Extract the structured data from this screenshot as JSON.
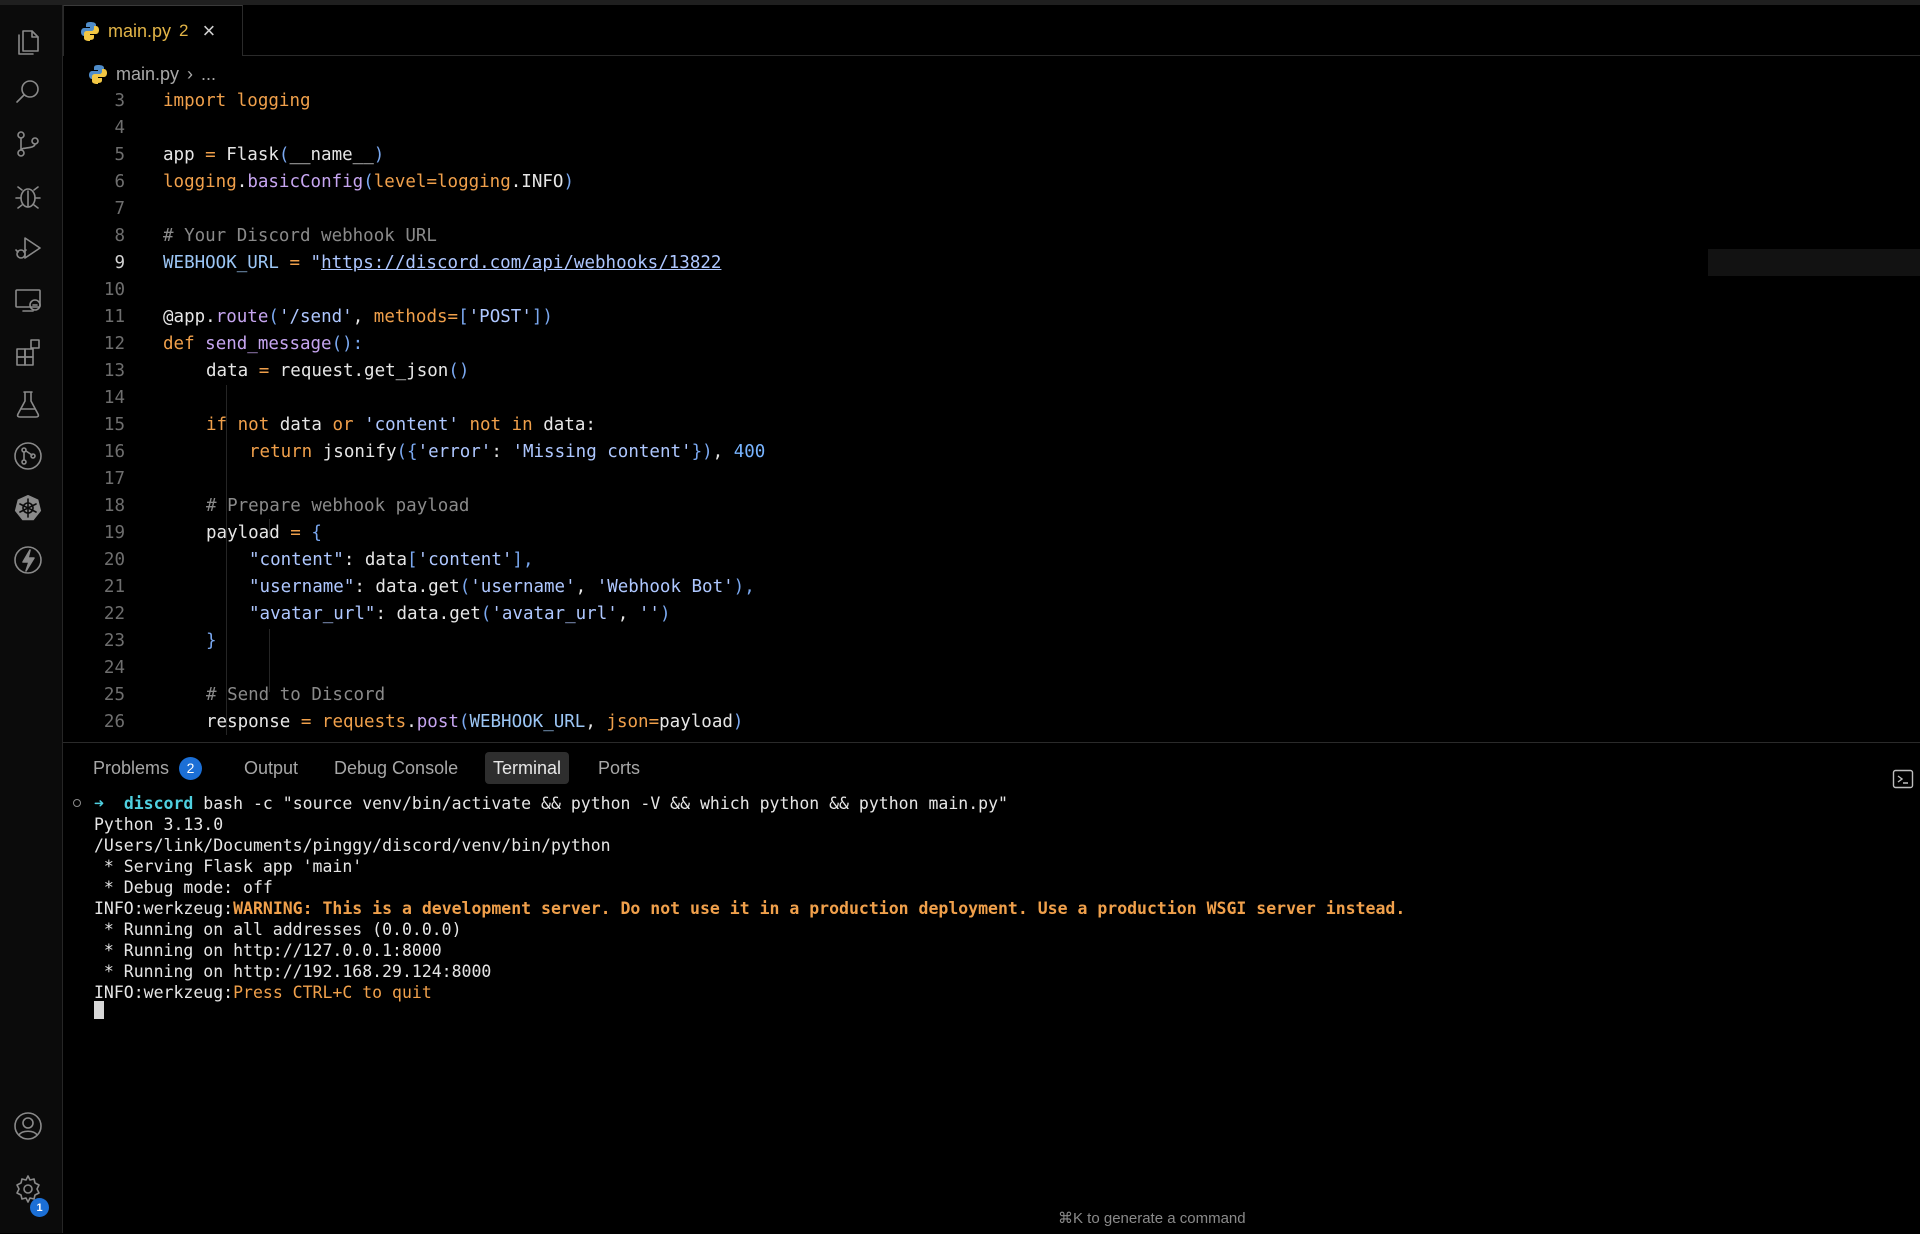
{
  "editor": {
    "tab": {
      "filename": "main.py",
      "problem_count": "2",
      "close_glyph": "×"
    },
    "breadcrumb": {
      "file": "main.py",
      "sep": "›",
      "rest": "..."
    },
    "lines": [
      {
        "n": "3"
      },
      {
        "n": "4"
      },
      {
        "n": "5"
      },
      {
        "n": "6"
      },
      {
        "n": "7"
      },
      {
        "n": "8"
      },
      {
        "n": "9"
      },
      {
        "n": "10"
      },
      {
        "n": "11"
      },
      {
        "n": "12"
      },
      {
        "n": "13"
      },
      {
        "n": "14"
      },
      {
        "n": "15"
      },
      {
        "n": "16"
      },
      {
        "n": "17"
      },
      {
        "n": "18"
      },
      {
        "n": "19"
      },
      {
        "n": "20"
      },
      {
        "n": "21"
      },
      {
        "n": "22"
      },
      {
        "n": "23"
      },
      {
        "n": "24"
      },
      {
        "n": "25"
      },
      {
        "n": "26"
      }
    ],
    "code": {
      "l3": [
        "import",
        " ",
        "logging"
      ],
      "l5": [
        "app",
        " = ",
        "Flask",
        "(",
        "__name__",
        ")"
      ],
      "l6": [
        "logging",
        ".",
        "basicConfig",
        "(",
        "level",
        "=",
        "logging",
        ".INFO",
        ")"
      ],
      "l8": "# Your Discord webhook URL",
      "l9": [
        "WEBHOOK_URL",
        " = ",
        "\"",
        "https://discord.com/api/webhooks/13822"
      ],
      "l11": [
        "@app",
        ".",
        "route",
        "(",
        "'/send'",
        ", ",
        "methods",
        "=",
        "[",
        "'POST'",
        "]",
        ")"
      ],
      "l12": [
        "def",
        " ",
        "send_message",
        "():"
      ],
      "l13": [
        "data",
        " = ",
        "request.get_json",
        "()"
      ],
      "l15": [
        "if",
        " ",
        "not",
        " data ",
        "or",
        " ",
        "'content'",
        " ",
        "not",
        " ",
        "in",
        " data:"
      ],
      "l16": [
        "return",
        " jsonify",
        "({",
        "'error'",
        ": ",
        "'Missing content'",
        "})",
        ", ",
        "400"
      ],
      "l18": "# Prepare webhook payload",
      "l19": [
        "payload",
        " = ",
        "{"
      ],
      "l20": [
        "\"content\"",
        ": data",
        "[",
        "'content'",
        "],"
      ],
      "l21": [
        "\"username\"",
        ": data.get",
        "(",
        "'username'",
        ", ",
        "'Webhook Bot'",
        "),"
      ],
      "l22": [
        "\"avatar_url\"",
        ": data.get",
        "(",
        "'avatar_url'",
        ", ",
        "''",
        ")"
      ],
      "l23": "}",
      "l25": "# Send to Discord",
      "l26": [
        "response",
        " = ",
        "requests",
        ".",
        "post",
        "(",
        "WEBHOOK_URL",
        ", ",
        "json",
        "=",
        "payload",
        ")"
      ]
    }
  },
  "panel": {
    "tabs": {
      "problems": "Problems",
      "problems_count": "2",
      "output": "Output",
      "debug_console": "Debug Console",
      "terminal": "Terminal",
      "ports": "Ports"
    },
    "terminal": {
      "prompt_arrow": "➜",
      "prompt_dir": "discord",
      "command": " bash -c \"source venv/bin/activate && python -V && which python && python main.py\"",
      "lines": [
        "Python 3.13.0",
        "/Users/link/Documents/pinggy/discord/venv/bin/python",
        " * Serving Flask app 'main'",
        " * Debug mode: off"
      ],
      "warn_prefix": "INFO:werkzeug:",
      "warn_text": "WARNING: This is a development server. Do not use it in a production deployment. Use a production WSGI server instead.",
      "lines2": [
        " * Running on all addresses (0.0.0.0)",
        " * Running on http://127.0.0.1:8000",
        " * Running on http://192.168.29.124:8000"
      ],
      "quit_prefix": "INFO:werkzeug:",
      "quit_text": "Press CTRL+C to quit"
    },
    "hint": "⌘K to generate a command"
  },
  "activity_bar": {
    "items": [
      "explorer-icon",
      "search-icon",
      "source-control-icon",
      "debug-icon",
      "run-debug-icon",
      "remote-explorer-icon",
      "extensions-icon",
      "testing-icon",
      "git-graph-icon",
      "kubernetes-icon",
      "lightning-icon"
    ],
    "bottom": [
      "account-icon",
      "settings-icon"
    ],
    "settings_badge": "1"
  }
}
